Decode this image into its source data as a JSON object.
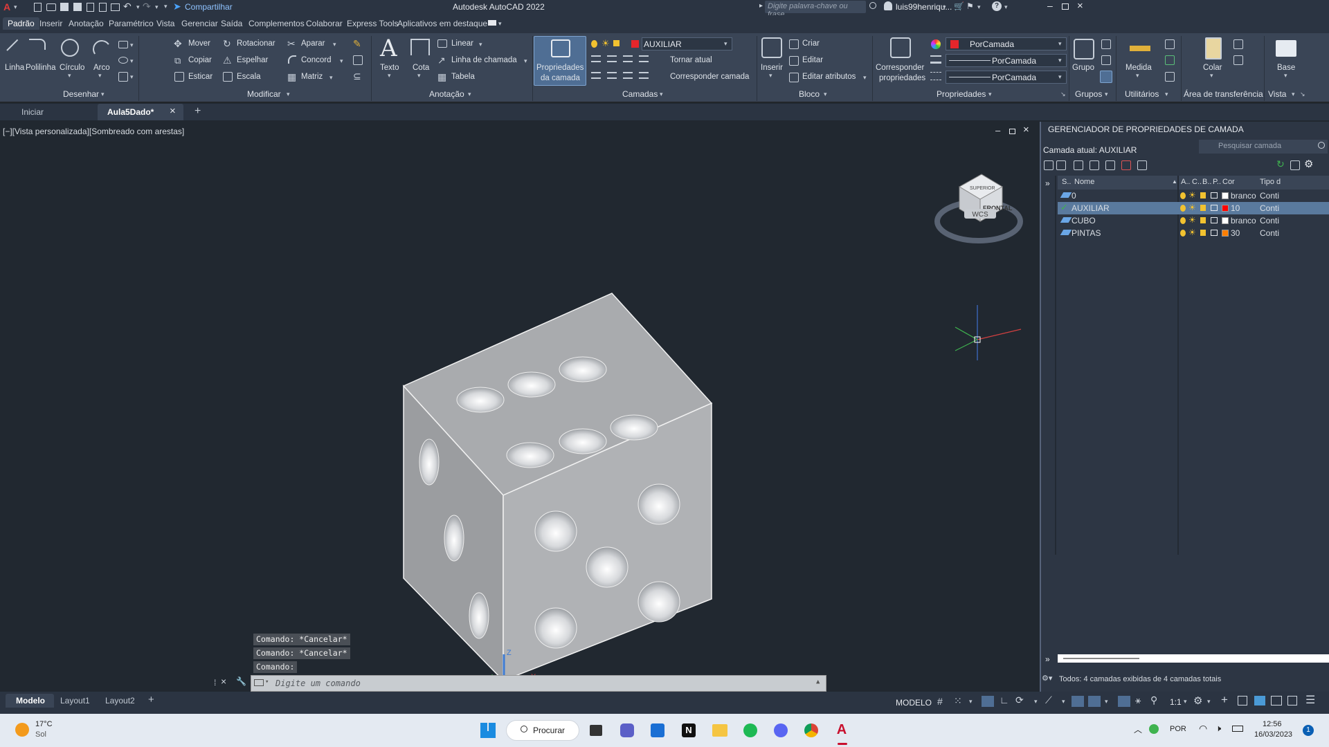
{
  "titlebar": {
    "app_title": "Autodesk AutoCAD 2022",
    "share_label": "Compartilhar",
    "search_placeholder": "Digite palavra-chave ou frase",
    "user": "luis99henriqu..."
  },
  "ribbon_tabs": [
    "Padrão",
    "Inserir",
    "Anotação",
    "Paramétrico",
    "Vista",
    "Gerenciar",
    "Saída",
    "Complementos",
    "Colaborar",
    "Express Tools",
    "Aplicativos em destaque"
  ],
  "ribbon": {
    "desenhar": {
      "title": "Desenhar",
      "linha": "Linha",
      "polilinha": "Polilinha",
      "circulo": "Círculo",
      "arco": "Arco"
    },
    "modificar": {
      "title": "Modificar",
      "mover": "Mover",
      "rotacionar": "Rotacionar",
      "aparar": "Aparar",
      "copiar": "Copiar",
      "espelhar": "Espelhar",
      "concord": "Concord",
      "esticar": "Esticar",
      "escala": "Escala",
      "matriz": "Matriz"
    },
    "anotacao": {
      "title": "Anotação",
      "texto": "Texto",
      "cota": "Cota",
      "linear": "Linear",
      "linha_chamada": "Linha de chamada",
      "tabela": "Tabela"
    },
    "camadas": {
      "title": "Camadas",
      "prop_camada_1": "Propriedades",
      "prop_camada_2": "da camada",
      "current_layer": "AUXILIAR",
      "tornar_atual": "Tornar atual",
      "corresponder_camada": "Corresponder camada"
    },
    "bloco": {
      "title": "Bloco",
      "inserir": "Inserir",
      "criar": "Criar",
      "editar": "Editar",
      "editar_atributos": "Editar atributos"
    },
    "propriedades": {
      "title": "Propriedades",
      "corresponder_1": "Corresponder",
      "corresponder_2": "propriedades",
      "cor": "PorCamada",
      "linha1": "PorCamada",
      "linha2": "PorCamada"
    },
    "grupos": {
      "title": "Grupos",
      "grupo": "Grupo"
    },
    "utilitarios": {
      "title": "Utilitários",
      "medida": "Medida"
    },
    "area": {
      "title": "Área de transferência",
      "colar": "Colar"
    },
    "vista": {
      "title": "Vista",
      "base": "Base"
    }
  },
  "doc_tabs": {
    "iniciar": "Iniciar",
    "active": "Aula5Dado*"
  },
  "viewport": {
    "label": "[−][Vista personalizada][Sombreado com arestas]",
    "viewcube_top": "SUPERIOR",
    "viewcube_front": "FRONTAL",
    "wcs": "WCS",
    "axis_x": "X",
    "axis_z": "Z"
  },
  "layer_panel": {
    "title": "GERENCIADOR DE PROPRIEDADES DE CAMADA",
    "current": "Camada atual: AUXILIAR",
    "search_placeholder": "Pesquisar camada",
    "headers": {
      "s": "S..",
      "nome": "Nome",
      "a": "A..",
      "c": "C..",
      "b": "B..",
      "p": "P..",
      "cor": "Cor",
      "tipo": "Tipo d"
    },
    "layers": [
      {
        "name": "0",
        "color_name": "branco",
        "color": "#ffffff",
        "tipo": "Conti"
      },
      {
        "name": "AUXILIAR",
        "color_name": "10",
        "color": "#ff0000",
        "tipo": "Conti"
      },
      {
        "name": "CUBO",
        "color_name": "branco",
        "color": "#ffffff",
        "tipo": "Conti"
      },
      {
        "name": "PINTAS",
        "color_name": "30",
        "color": "#ff7f00",
        "tipo": "Conti"
      }
    ],
    "footer": "Todos: 4 camadas exibidas de 4 camadas totais"
  },
  "command": {
    "history": [
      "Comando: *Cancelar*",
      "Comando: *Cancelar*",
      "Comando:"
    ],
    "placeholder": "Digite um comando"
  },
  "layout_tabs": [
    "Modelo",
    "Layout1",
    "Layout2"
  ],
  "status": {
    "modelo": "MODELO",
    "scale": "1:1"
  },
  "taskbar": {
    "weather_temp": "17°C",
    "weather_desc": "Sol",
    "search": "Procurar",
    "lang": "POR",
    "time": "12:56",
    "date": "16/03/2023",
    "notif": "1"
  },
  "colors": {
    "accent": "#5a7a9e",
    "autocad_red": "#c8102e"
  }
}
